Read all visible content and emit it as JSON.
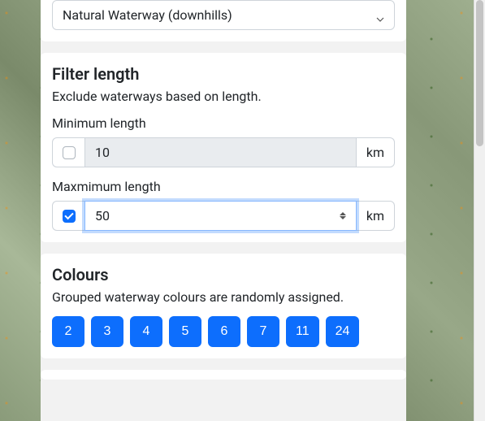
{
  "waterway_select": {
    "selected": "Natural Waterway (downhills)"
  },
  "filter_length": {
    "title": "Filter length",
    "description": "Exclude waterways based on length.",
    "min": {
      "label": "Minimum length",
      "enabled": false,
      "value": "10",
      "unit": "km"
    },
    "max": {
      "label": "Maxmimum length",
      "enabled": true,
      "value": "50",
      "unit": "km"
    }
  },
  "colours": {
    "title": "Colours",
    "description": "Grouped waterway colours are randomly assigned.",
    "buttons": [
      "2",
      "3",
      "4",
      "5",
      "6",
      "7",
      "11",
      "24"
    ]
  }
}
